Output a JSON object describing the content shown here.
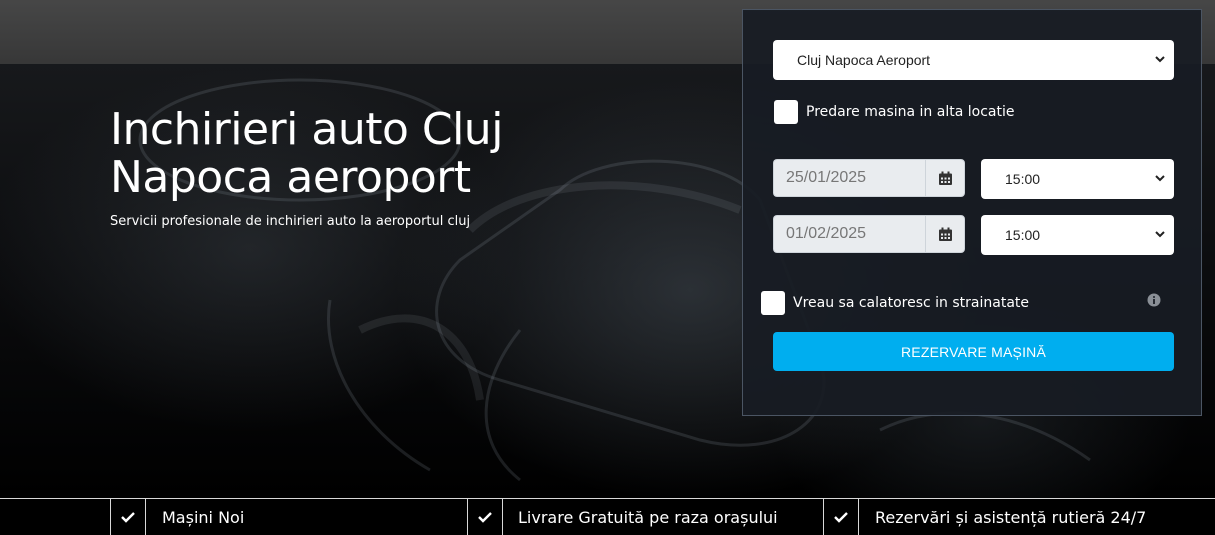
{
  "hero": {
    "title": "Inchirieri auto Cluj Napoca aeroport",
    "subtitle": "Servicii profesionale de inchirieri auto la aeroportul cluj"
  },
  "booking": {
    "location_select": "Cluj Napoca Aeroport",
    "different_return_label": "Predare masina in alta locatie",
    "pickup_date": "25/01/2025",
    "pickup_time": "15:00",
    "return_date": "01/02/2025",
    "return_time": "15:00",
    "abroad_label": "Vreau sa calatoresc in strainatate",
    "reserve_button": "REZERVARE MAȘINĂ",
    "accent_color": "#00aeef"
  },
  "features": [
    {
      "label": "Mașini Noi",
      "icon": "check-icon"
    },
    {
      "label": "Livrare Gratuită pe raza orașului",
      "icon": "check-icon"
    },
    {
      "label": "Rezervări și asistență rutieră 24/7",
      "icon": "check-icon"
    }
  ]
}
